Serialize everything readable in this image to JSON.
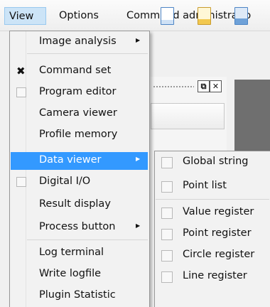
{
  "menubar": {
    "view": "View",
    "options": "Options",
    "command_admin": "Command administratio"
  },
  "view_menu": {
    "items": [
      {
        "label": "Image analysis",
        "submenu": true,
        "checkbox": "none"
      },
      {
        "label": "Command set",
        "checkbox": "checked"
      },
      {
        "label": "Program editor",
        "checkbox": "empty"
      },
      {
        "label": "Camera viewer",
        "checkbox": "none"
      },
      {
        "label": "Profile memory",
        "checkbox": "none"
      },
      {
        "label": "Data viewer",
        "submenu": true,
        "checkbox": "none",
        "highlighted": true
      },
      {
        "label": "Digital I/O",
        "checkbox": "empty"
      },
      {
        "label": "Result display",
        "checkbox": "none"
      },
      {
        "label": "Process button",
        "submenu": true,
        "checkbox": "none"
      },
      {
        "label": "Log terminal",
        "checkbox": "none"
      },
      {
        "label": "Write logfile",
        "checkbox": "none"
      },
      {
        "label": "Plugin Statistic",
        "checkbox": "none"
      }
    ]
  },
  "data_viewer_menu": {
    "items": [
      {
        "label": "Global string"
      },
      {
        "label": "Point list"
      },
      {
        "label": "Value register"
      },
      {
        "label": "Point register"
      },
      {
        "label": "Circle register"
      },
      {
        "label": "Line register"
      }
    ]
  },
  "glyphs": {
    "submenu_arrow": "▶",
    "check_mark": "✖",
    "float_button": "⧉",
    "close_button": "✕"
  },
  "colors": {
    "highlight": "#3399ff",
    "menubar_active": "#cce4f7"
  }
}
